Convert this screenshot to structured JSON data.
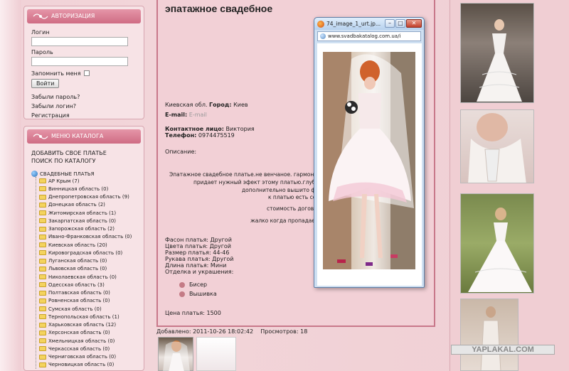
{
  "auth": {
    "header": "АВТОРИЗАЦИЯ",
    "login_label": "Логин",
    "password_label": "Пароль",
    "remember_label": "Запомнить меня",
    "login_button": "Войти",
    "forgot_password": "Забыли пароль?",
    "forgot_login": "Забыли логин?",
    "register": "Регистрация"
  },
  "catalog": {
    "header": "МЕНЮ КАТАЛОГА",
    "add_dress": "ДОБАВИТЬ СВОЕ ПЛАТЬЕ",
    "search": "ПОИСК ПО КАТАЛОГУ",
    "root": "СВАДЕБНЫЕ ПЛАТЬЯ",
    "items": [
      "АР Крым (7)",
      "Винницкая область (0)",
      "Днепропетровская область (9)",
      "Донецкая область (2)",
      "Житомирская область (1)",
      "Закарпатская область (0)",
      "Запорожская область (2)",
      "Ивано-Франковская область (0)",
      "Киевская область (20)",
      "Кировоградская область (0)",
      "Луганская область (0)",
      "Львовская область (0)",
      "Николаевская область (0)",
      "Одесская область (3)",
      "Полтавская область (0)",
      "Ровненская область (0)",
      "Сумская область (0)",
      "Тернопольская область (1)",
      "Харьковская область (12)",
      "Херсонская область (0)",
      "Хмельницкая область (0)",
      "Черкасская область (0)",
      "Черниговская область (0)",
      "Черновицкая область (0)"
    ]
  },
  "listing": {
    "title": "эпатажное свадебное",
    "region": "Киевская обл.",
    "city_label": "Город:",
    "city": "Киев",
    "email_label": "E-mail:",
    "email_value": "E-mail",
    "contact_label": "Контактное лицо:",
    "contact": "Виктория",
    "phone_label": "Телефон:",
    "phone": "0974475519",
    "description_label": "Описание:",
    "description_lines": [
      "Эпатажное свадебное платье.не венчаное. гармония 3-х",
      "придает нужный эфект этому платью.глубокое",
      "дополнительно вышито фото",
      "к платью есть сер",
      "стоимость договор",
      "жалко когда пропадает т"
    ],
    "props": [
      "Фасон платья: Другой",
      "Цвета платья: Другой",
      "Размер платья: 44-46",
      "Рукава платья: Другой",
      "Длина платья: Мини",
      "Отделка и украшения:"
    ],
    "decorations": [
      "Бисер",
      "Вышивка"
    ],
    "price": "Цена платья: 1500",
    "added": "Добавлено: 2011-10-26 18:02:42",
    "views": "Просмотров: 18"
  },
  "popup": {
    "title": "74_image_1_urt.jp...",
    "url": "www.svadbakatalog.com.ua/i",
    "buttons": [
      "–",
      "□",
      "✕"
    ]
  },
  "watermark": "YAPLAKAL.COM",
  "colors": {
    "header_pink": "#cf6c84",
    "panel_border": "#c8788a",
    "bullet": "#c47b86"
  }
}
